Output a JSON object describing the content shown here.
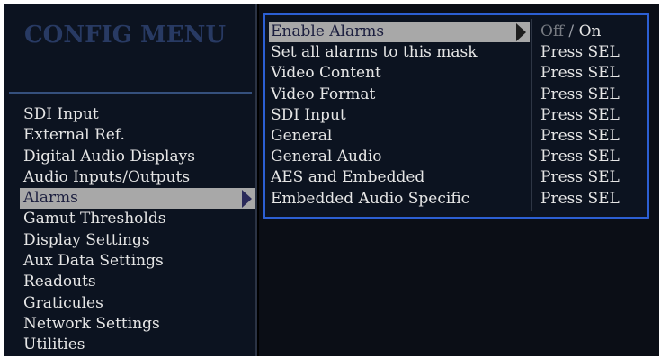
{
  "title": "CONFIG MENU",
  "menu": {
    "items": [
      {
        "label": "SDI Input"
      },
      {
        "label": "External Ref."
      },
      {
        "label": "Digital Audio Displays"
      },
      {
        "label": "Audio Inputs/Outputs"
      },
      {
        "label": "Alarms",
        "selected": true
      },
      {
        "label": "Gamut Thresholds"
      },
      {
        "label": "Display Settings"
      },
      {
        "label": "Aux Data Settings"
      },
      {
        "label": "Readouts"
      },
      {
        "label": "Graticules"
      },
      {
        "label": "Network Settings"
      },
      {
        "label": "Utilities"
      }
    ]
  },
  "submenu": {
    "enable": {
      "label": "Enable Alarms",
      "value_off": "Off",
      "value_sep": "/",
      "value_on": "On"
    },
    "rows": [
      {
        "label": "Set all alarms to this mask",
        "value": "Press SEL"
      },
      {
        "label": "Video Content",
        "value": "Press SEL"
      },
      {
        "label": "Video Format",
        "value": "Press SEL"
      },
      {
        "label": "SDI Input",
        "value": "Press SEL"
      },
      {
        "label": "General",
        "value": "Press SEL"
      },
      {
        "label": "General Audio",
        "value": "Press SEL"
      },
      {
        "label": "AES and Embedded",
        "value": "Press SEL"
      },
      {
        "label": "Embedded Audio Specific",
        "value": "Press SEL"
      }
    ]
  },
  "colors": {
    "highlight": "#a8a8a8",
    "submenu_border": "#2c5fd3",
    "title": "#283a63"
  }
}
